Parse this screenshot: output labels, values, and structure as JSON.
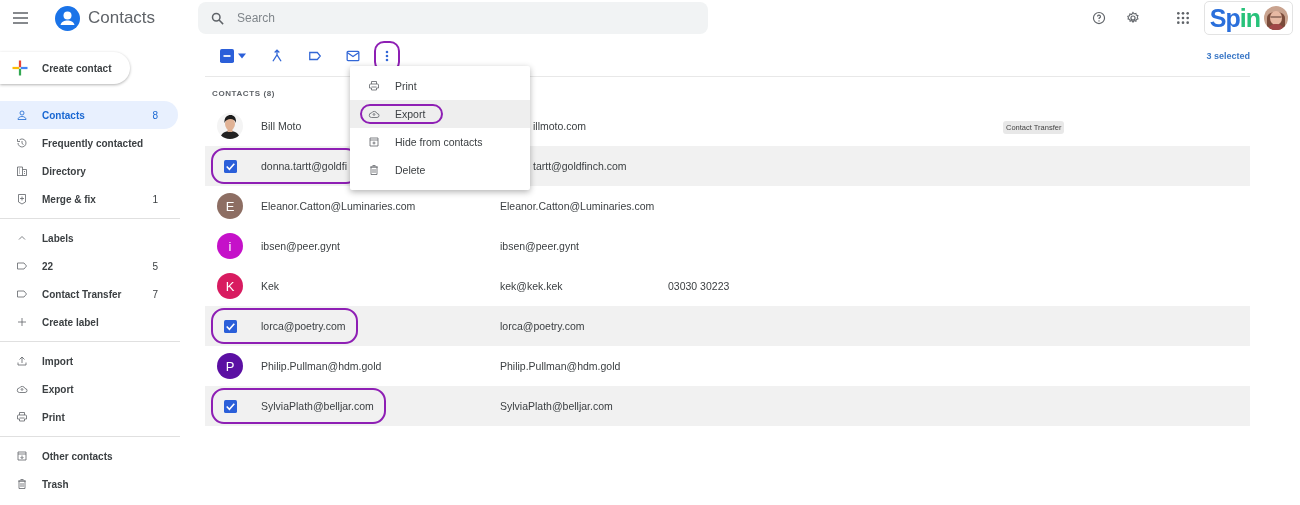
{
  "app": {
    "title": "Contacts"
  },
  "search": {
    "placeholder": "Search"
  },
  "brand": {
    "parts": [
      {
        "text": "Sp",
        "color": "#2a6fdb"
      },
      {
        "text": "in",
        "color": "#27c27a"
      }
    ]
  },
  "create_button": {
    "label": "Create contact"
  },
  "sidebar": {
    "sections": [
      {
        "items": [
          {
            "kind": "person",
            "label": "Contacts",
            "count": "8",
            "selected": true
          },
          {
            "kind": "history",
            "label": "Frequently contacted",
            "selected": false
          },
          {
            "kind": "directory",
            "label": "Directory",
            "selected": false
          },
          {
            "kind": "merge",
            "label": "Merge & fix",
            "count": "1",
            "selected": false
          }
        ]
      },
      {
        "header": {
          "label": "Labels",
          "expanded": true
        },
        "items": [
          {
            "kind": "label",
            "label": "22",
            "count": "5",
            "selected": false
          },
          {
            "kind": "label",
            "label": "Contact Transfer",
            "count": "7",
            "selected": false
          },
          {
            "kind": "plus",
            "label": "Create label",
            "selected": false
          }
        ]
      },
      {
        "items": [
          {
            "kind": "import",
            "label": "Import",
            "selected": false
          },
          {
            "kind": "export",
            "label": "Export",
            "selected": false
          },
          {
            "kind": "print",
            "label": "Print",
            "selected": false
          }
        ]
      },
      {
        "items": [
          {
            "kind": "other",
            "label": "Other contacts",
            "selected": false
          },
          {
            "kind": "trash",
            "label": "Trash",
            "selected": false
          }
        ]
      }
    ]
  },
  "toolbar": {
    "select_all": {
      "indeterminate": true
    },
    "more_annotated": true,
    "selection_count": "3 selected"
  },
  "list": {
    "heading": "CONTACTS (8)",
    "rows": [
      {
        "name": "Bill Moto",
        "email": "illmoto.com",
        "email_covered": true,
        "label": "Contact Transfer",
        "selected": false
      },
      {
        "name": "donna.tartt@goldfi",
        "email": "tartt@goldfinch.com",
        "email_covered": true,
        "selected": true,
        "annotated": true
      },
      {
        "name": "Eleanor.Catton@Luminaries.com",
        "email": "Eleanor.Catton@Luminaries.com",
        "email_covered": false,
        "selected": false,
        "avatar": {
          "kind": "letter",
          "letter": "E",
          "color": "#8d6e63"
        }
      },
      {
        "name": "ibsen@peer.gynt",
        "email": "ibsen@peer.gynt",
        "email_covered": false,
        "selected": false,
        "avatar": {
          "kind": "letter",
          "letter": "i",
          "color": "#c511c9"
        }
      },
      {
        "name": "Kek",
        "email": "kek@kek.kek",
        "email_covered": false,
        "phone": "03030 30223",
        "selected": false,
        "avatar": {
          "kind": "letter",
          "letter": "K",
          "color": "#d81b60"
        }
      },
      {
        "name": "lorca@poetry.com",
        "email": "lorca@poetry.com",
        "email_covered": false,
        "selected": true,
        "annotated": true
      },
      {
        "name": "Philip.Pullman@hdm.gold",
        "email": "Philip.Pullman@hdm.gold",
        "email_covered": false,
        "selected": false,
        "avatar": {
          "kind": "letter",
          "letter": "P",
          "color": "#5b0fa3"
        }
      },
      {
        "name": "SylviaPlath@belljar.com",
        "email": "SylviaPlath@belljar.com",
        "email_covered": false,
        "selected": true,
        "annotated": true
      }
    ]
  },
  "menu": {
    "items": [
      {
        "kind": "print",
        "label": "Print",
        "selected": false
      },
      {
        "kind": "export",
        "label": "Export",
        "selected": true,
        "annotated": true
      },
      {
        "kind": "hide",
        "label": "Hide from contacts",
        "selected": false
      },
      {
        "kind": "trash",
        "label": "Delete",
        "selected": false
      }
    ]
  }
}
